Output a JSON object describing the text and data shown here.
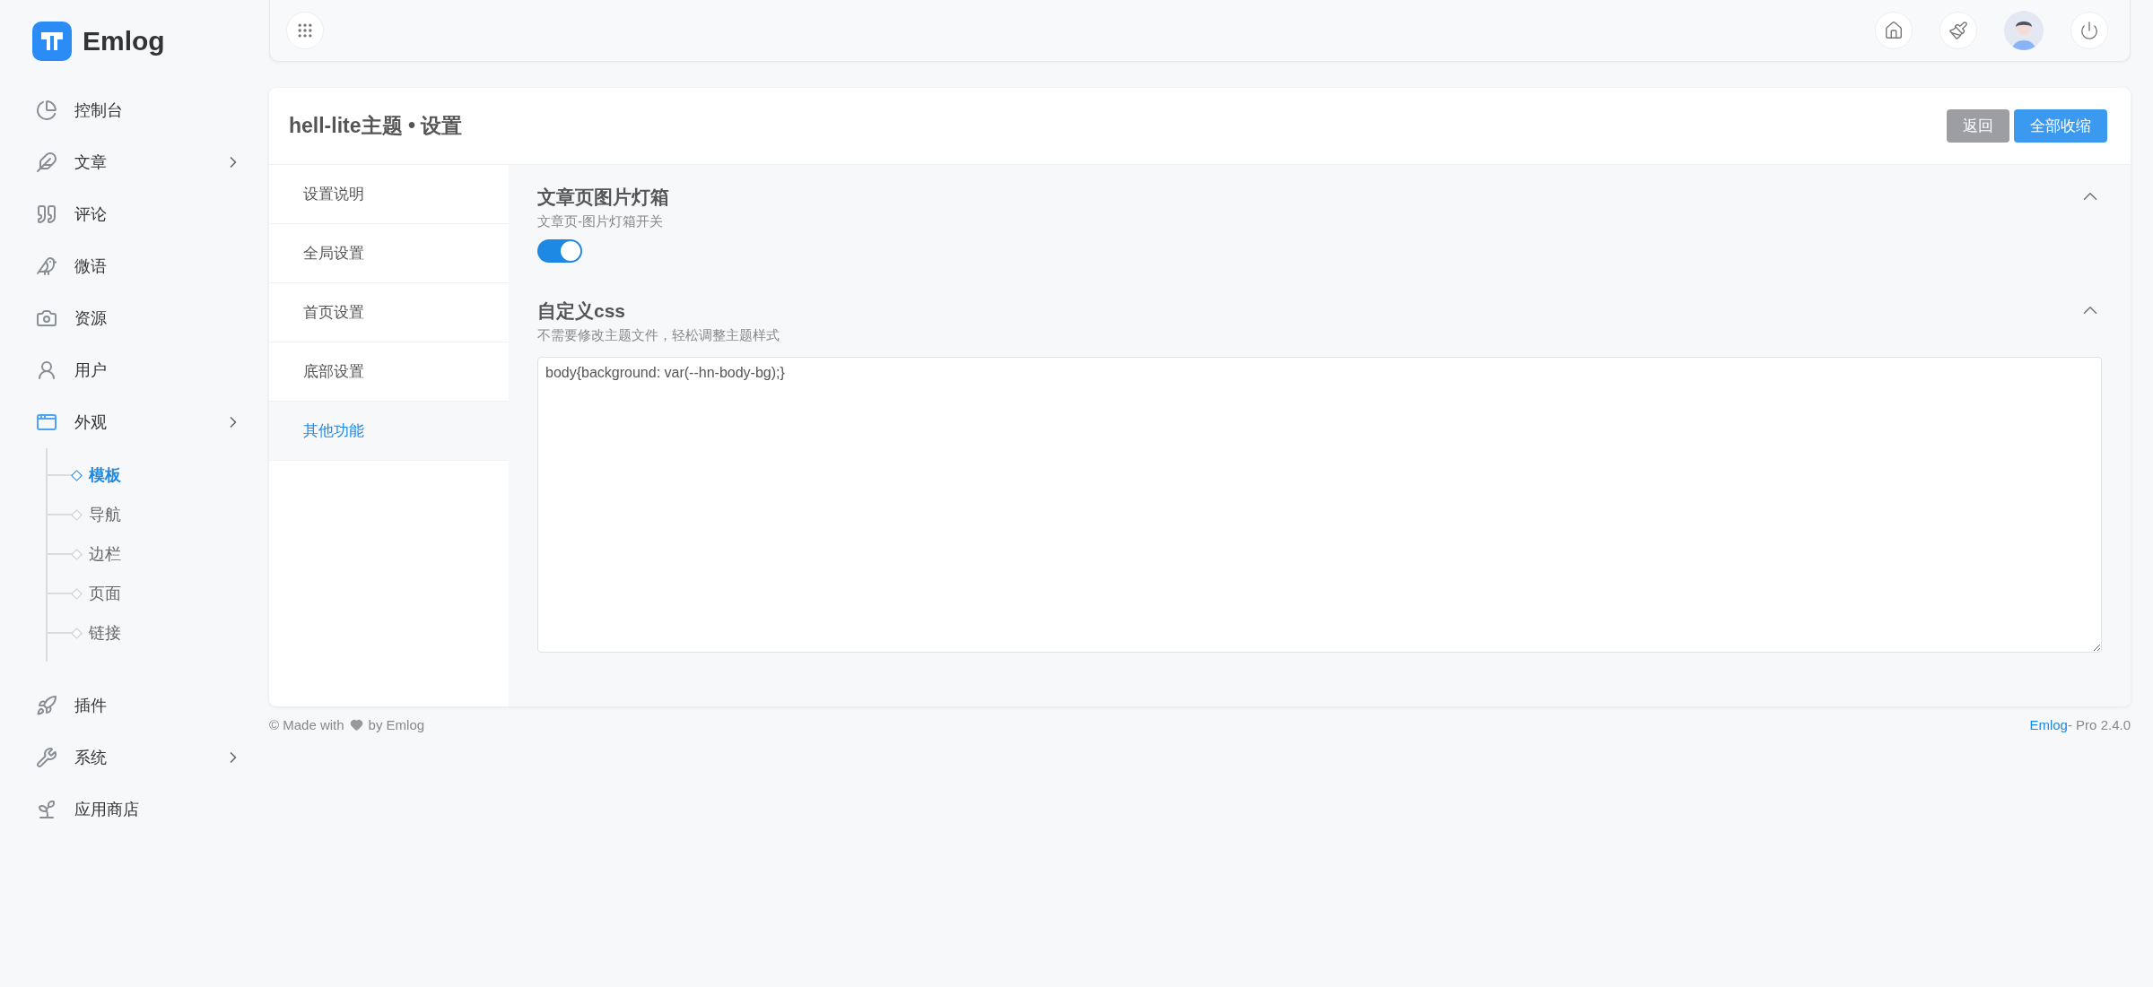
{
  "brand": {
    "name": "Emlog"
  },
  "sidebar": {
    "items": [
      {
        "label": "控制台",
        "has_submenu": false
      },
      {
        "label": "文章",
        "has_submenu": true
      },
      {
        "label": "评论",
        "has_submenu": false
      },
      {
        "label": "微语",
        "has_submenu": false
      },
      {
        "label": "资源",
        "has_submenu": false
      },
      {
        "label": "用户",
        "has_submenu": false
      },
      {
        "label": "外观",
        "has_submenu": true,
        "children": [
          {
            "label": "模板",
            "selected": true
          },
          {
            "label": "导航",
            "selected": false
          },
          {
            "label": "边栏",
            "selected": false
          },
          {
            "label": "页面",
            "selected": false
          },
          {
            "label": "链接",
            "selected": false
          }
        ]
      },
      {
        "label": "插件",
        "has_submenu": false
      },
      {
        "label": "系统",
        "has_submenu": true
      },
      {
        "label": "应用商店",
        "has_submenu": false
      }
    ]
  },
  "page": {
    "title": "hell-lite主题 • 设置",
    "buttons": [
      {
        "label": "返回",
        "kind": "secondary"
      },
      {
        "label": "全部收缩",
        "kind": "primary"
      }
    ],
    "tabs": [
      {
        "label": "设置说明",
        "selected": false
      },
      {
        "label": "全局设置",
        "selected": false
      },
      {
        "label": "首页设置",
        "selected": false
      },
      {
        "label": "底部设置",
        "selected": false
      },
      {
        "label": "其他功能",
        "selected": true
      }
    ],
    "sections": [
      {
        "kind": "switch",
        "title": "文章页图片灯箱",
        "description": "文章页-图片灯箱开关",
        "expanded": true,
        "on": true
      },
      {
        "kind": "textarea",
        "title": "自定义css",
        "description": "不需要修改主题文件，轻松调整主题样式",
        "expanded": true,
        "value": "body{background: var(--hn-body-bg);}"
      }
    ]
  },
  "footer": {
    "made_with": "© Made with",
    "by": "by Emlog",
    "link": "Emlog",
    "version": "- Pro 2.4.0"
  }
}
